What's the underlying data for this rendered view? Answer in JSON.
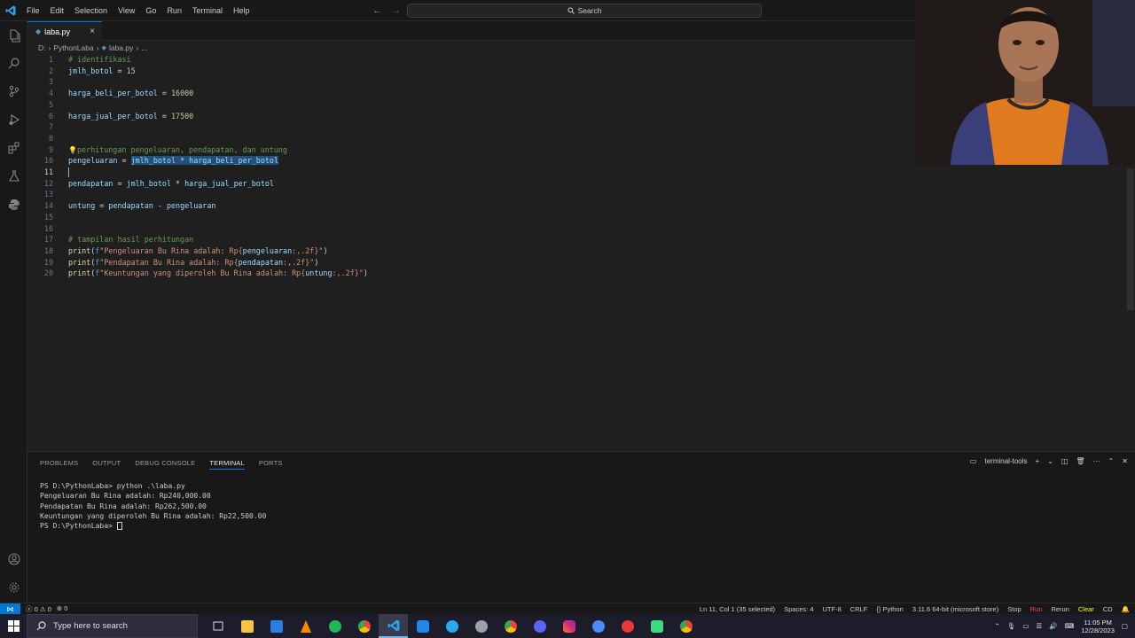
{
  "menu": [
    "File",
    "Edit",
    "Selection",
    "View",
    "Go",
    "Run",
    "Terminal",
    "Help"
  ],
  "search": {
    "label": "Search"
  },
  "tab": {
    "name": "laba.py",
    "close": "×"
  },
  "breadcrumb": {
    "drive": "D:",
    "folder": "PythonLaba",
    "file": "laba.py",
    "more": "..."
  },
  "editor": {
    "lines": [
      {
        "n": "1"
      },
      {
        "n": "2"
      },
      {
        "n": "3"
      },
      {
        "n": "4"
      },
      {
        "n": "5"
      },
      {
        "n": "6"
      },
      {
        "n": "7"
      },
      {
        "n": "8"
      },
      {
        "n": "9"
      },
      {
        "n": "10"
      },
      {
        "n": "11"
      },
      {
        "n": "12"
      },
      {
        "n": "13"
      },
      {
        "n": "14"
      },
      {
        "n": "15"
      },
      {
        "n": "16"
      },
      {
        "n": "17"
      },
      {
        "n": "18"
      },
      {
        "n": "19"
      },
      {
        "n": "20"
      }
    ],
    "code": {
      "l1": "# identifikasi",
      "l2_var": "jmlh_botol",
      "l2_op": " = ",
      "l2_num": "15",
      "l4_var": "harga_beli_per_botol",
      "l4_op": " = ",
      "l4_num": "16000",
      "l6_var": "harga_jual_per_botol",
      "l6_op": " = ",
      "l6_num": "17500",
      "l9": "perhitungan pengeluaran, pendapatan, dan untung",
      "l10_var": "pengeluaran",
      "l10_op": " = ",
      "l10_sel": "jmlh_botol * harga_beli_per_botol",
      "l12_var": "pendapatan",
      "l12_op": " = ",
      "l12_a": "jmlh_botol",
      "l12_op2": " * ",
      "l12_b": "harga_jual_per_botol",
      "l14_var": "untung",
      "l14_op": " = ",
      "l14_a": "pendapatan",
      "l14_op2": " - ",
      "l14_b": "pengeluaran",
      "l17": "# tampilan hasil perhitungan",
      "l18_fn": "print",
      "l18_pre": "(",
      "l18_f": "f",
      "l18_s1": "\"Pengeluaran Bu Rina adalah: Rp{",
      "l18_v": "pengeluaran",
      "l18_s2": ":,.2f}\"",
      "l18_post": ")",
      "l19_fn": "print",
      "l19_pre": "(",
      "l19_f": "f",
      "l19_s1": "\"Pendapatan Bu Rina adalah: Rp{",
      "l19_v": "pendapatan",
      "l19_s2": ":,.2f}\"",
      "l19_post": ")",
      "l20_fn": "print",
      "l20_pre": "(",
      "l20_f": "f",
      "l20_s1": "\"Keuntungan yang diperoleh Bu Rina adalah: Rp{",
      "l20_v": "untung",
      "l20_s2": ":,.2f}\"",
      "l20_post": ")"
    }
  },
  "panel": {
    "tabs": [
      "PROBLEMS",
      "OUTPUT",
      "DEBUG CONSOLE",
      "TERMINAL",
      "PORTS"
    ],
    "terminal_name": "terminal-tools",
    "terminal_lines": [
      "PS D:\\PythonLaba> python .\\laba.py",
      "Pengeluaran Bu Rina adalah: Rp240,000.00",
      "Pendapatan Bu Rina adalah: Rp262,500.00",
      "Keuntungan yang diperoleh Bu Rina adalah: Rp22,500.00",
      "PS D:\\PythonLaba> "
    ]
  },
  "status": {
    "errors": "0",
    "warnings": "0",
    "ports": "0",
    "position": "Ln 11, Col 1 (35 selected)",
    "spaces": "Spaces: 4",
    "encoding": "UTF-8",
    "eol": "CRLF",
    "language": "Python",
    "interpreter": "3.11.6 64-bit (microsoft store)",
    "stop": "Stop",
    "run": "Run",
    "rerun": "Rerun",
    "clear": "Clear",
    "cd": "CD"
  },
  "taskbar": {
    "search_placeholder": "Type here to search",
    "time": "11:05 PM",
    "date": "12/28/2023"
  },
  "colors": {
    "accent": "#0078d4",
    "selection": "#264f78",
    "background": "#1f1f1f"
  }
}
